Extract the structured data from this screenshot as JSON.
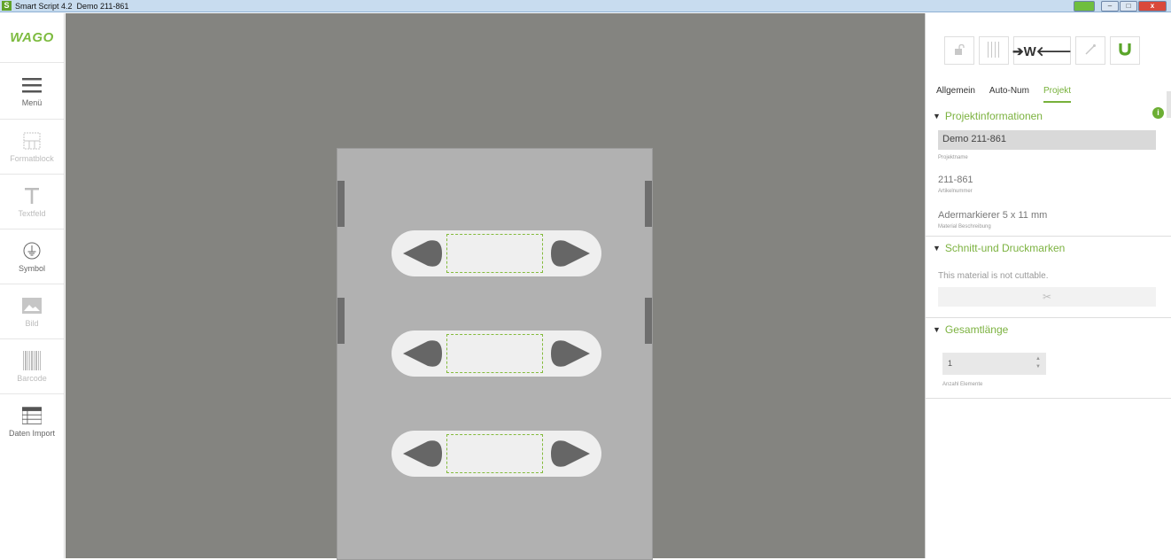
{
  "window": {
    "title": "Smart Script 4.2  Demo 211-861",
    "app_icon_letter": "S"
  },
  "sidebar": {
    "logo": "WAGO",
    "tools": [
      {
        "label": "Menü",
        "icon": "hamburger-icon",
        "enabled": true
      },
      {
        "label": "Formatblock",
        "icon": "format-block-icon",
        "enabled": false
      },
      {
        "label": "Textfeld",
        "icon": "text-field-icon",
        "enabled": false
      },
      {
        "label": "Symbol",
        "icon": "ground-symbol-icon",
        "enabled": true
      },
      {
        "label": "Bild",
        "icon": "image-icon",
        "enabled": false
      },
      {
        "label": "Barcode",
        "icon": "barcode-icon",
        "enabled": false
      },
      {
        "label": "Daten Import",
        "icon": "table-import-icon",
        "enabled": true
      }
    ]
  },
  "canvas": {
    "markers_count": 3
  },
  "panel": {
    "toolbar": {
      "lock_icon": "lock-icon",
      "columns_icon": "columns-icon",
      "align_label": "➔W🡐",
      "wand_icon": "magic-wand-icon",
      "magnet_icon": "magnet-icon"
    },
    "tabs": [
      "Allgemein",
      "Auto-Num",
      "Projekt"
    ],
    "active_tab": "Projekt",
    "projektinfo": {
      "heading": "Projektinformationen",
      "project_name": "Demo 211-861",
      "project_name_caption": "Projektname",
      "article_number": "211-861",
      "article_number_caption": "Artikelnummer",
      "material": "Adermarkierer 5 x 11 mm",
      "material_caption": "Material Beschreibung"
    },
    "schnitt": {
      "heading": "Schnitt-und Druckmarken",
      "note": "This material is not cuttable.",
      "cut_icon": "✂"
    },
    "gesamtlaenge": {
      "heading": "Gesamtlänge",
      "count_value": "1",
      "count_caption": "Anzahl Elemente"
    },
    "colors": {
      "accent": "#77b13a",
      "canvas": "#848480",
      "sheet": "#b1b1b1"
    }
  }
}
